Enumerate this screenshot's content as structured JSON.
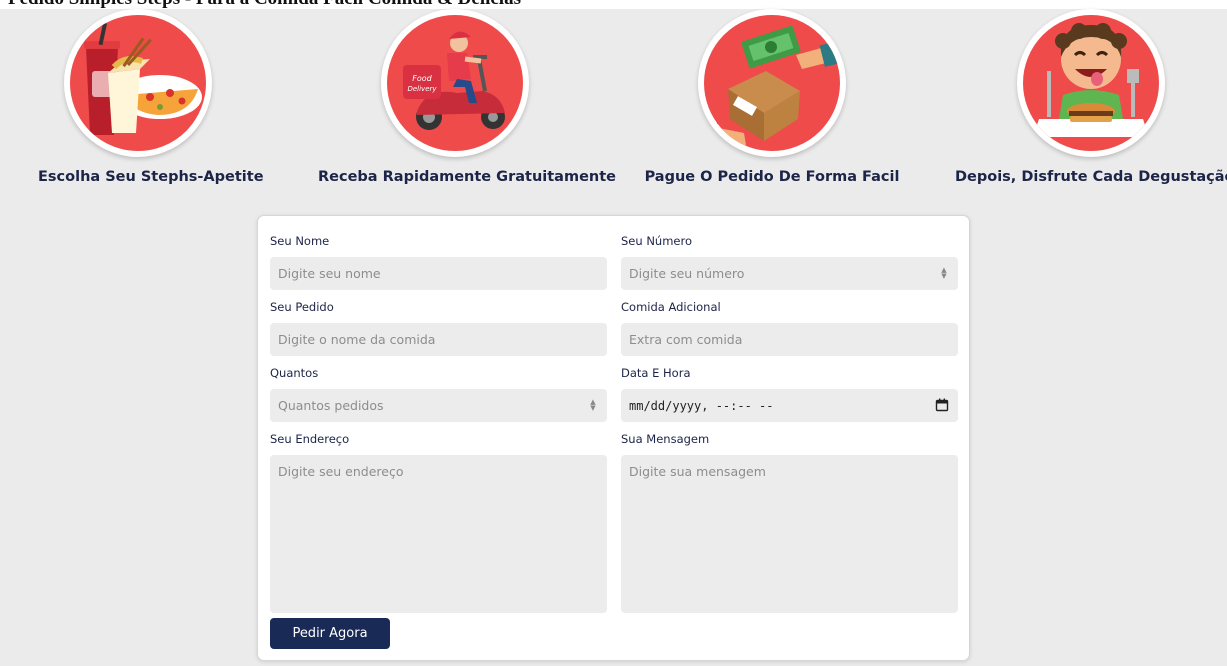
{
  "header": {
    "partial_title": "Pedido Simples Steps - Para a Comida Fácil Comida & Delícias"
  },
  "steps": [
    {
      "label": "Escolha Seu Stephs-Apetite",
      "icon": "food-combo-icon"
    },
    {
      "label": "Receba Rapidamente Gratuitamente",
      "icon": "delivery-scooter-icon"
    },
    {
      "label": "Pague O Pedido De Forma Facil",
      "icon": "payment-exchange-icon"
    },
    {
      "label": "Depois, Disfrute Cada Degustação",
      "icon": "happy-eater-icon"
    }
  ],
  "form": {
    "name": {
      "label": "Seu Nome",
      "placeholder": "Digite seu nome"
    },
    "number": {
      "label": "Seu Número",
      "placeholder": "Digite seu número"
    },
    "order": {
      "label": "Seu Pedido",
      "placeholder": "Digite o nome da comida"
    },
    "extra": {
      "label": "Comida Adicional",
      "placeholder": "Extra com comida"
    },
    "quantity": {
      "label": "Quantos",
      "placeholder": "Quantos pedidos"
    },
    "datetime": {
      "label": "Data E Hora",
      "value": "mm/dd/yyyy, --:-- --"
    },
    "address": {
      "label": "Seu Endereço",
      "placeholder": "Digite seu endereço"
    },
    "message": {
      "label": "Sua Mensagem",
      "placeholder": "Digite sua mensagem"
    },
    "submit_label": "Pedir Agora"
  },
  "colors": {
    "accent_red": "#ef4b4b",
    "button_navy": "#192a56",
    "label_navy": "#1c2448"
  }
}
